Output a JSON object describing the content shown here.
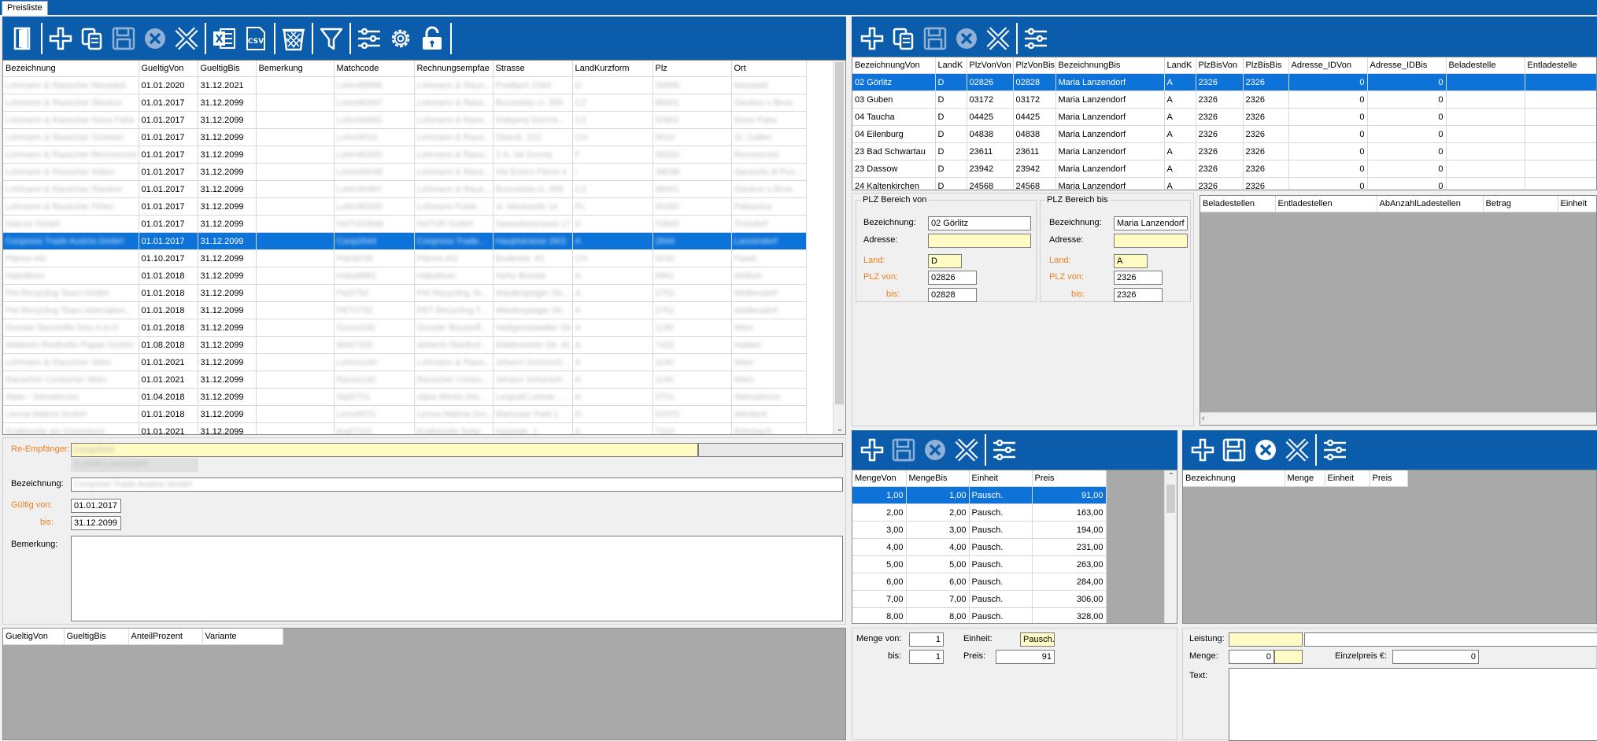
{
  "window": {
    "tab_title": "Preisliste"
  },
  "main_table": {
    "headers": [
      "Bezeichnung",
      "GueltigVon",
      "GueltigBis",
      "Bemerkung",
      "Matchcode",
      "Rechnungsempfae",
      "Strasse",
      "LandKurzform",
      "Plz",
      "Ort"
    ],
    "rows": [
      [
        "Lohmann & Rauscher Neuwied",
        "01.01.2020",
        "31.12.2021",
        "",
        "Lohm90996",
        "Lohmann & Raus...",
        "Postfach 2343",
        "D",
        "56566",
        "Neuwied"
      ],
      [
        "Lohmann & Rauscher Slavkov",
        "01.01.2017",
        "31.12.2099",
        "",
        "Lohm90497",
        "Lohmann & Raus...",
        "Bucovicka cl. 356",
        "CZ",
        "68401",
        "Slavkov u Brna"
      ],
      [
        "Lohmann & Rauscher Nova Paka",
        "01.01.2017",
        "31.12.2099",
        "",
        "Lohm90981",
        "Lohmann & Raus...",
        "Kldeprny Dorrcil...",
        "CZ",
        "50901",
        "Nova Paka"
      ],
      [
        "Lohmann & Rauscher Schweiz",
        "01.01.2017",
        "31.12.2099",
        "",
        "Lohm9014",
        "Lohmann & Raus...",
        "Oberdr. 222",
        "CH",
        "9014",
        "St. Gallen"
      ],
      [
        "Lohmann & Rauscher Rennesroot",
        "01.01.2017",
        "31.12.2099",
        "",
        "Lohm90200",
        "Lohmann & Raus...",
        "Z.A. Se Dromy",
        "F",
        "08200",
        "Rennesroot"
      ],
      [
        "Lohmann & Rauscher Italien",
        "01.01.2017",
        "31.12.2099",
        "",
        "Lohm39038",
        "Lohmann & Raus...",
        "Via Enrico Fermi 4",
        "I",
        "39038",
        "Sansorla di Pus..."
      ],
      [
        "Lohmann & Rauscher Slavkov",
        "01.01.2017",
        "31.12.2099",
        "",
        "Lohm90497",
        "Lohmann & Raus...",
        "Bucovicka cl. 356",
        "CZ",
        "68401",
        "Slavkov u Brna"
      ],
      [
        "Lohmann & Rauscher Polen",
        "01.01.2017",
        "31.12.2099",
        "",
        "Lohm95200",
        "Lohmann Polsk...",
        "ul. Moniuszki 14",
        "PL",
        "95200",
        "Pabianice"
      ],
      [
        "Natuvir GmbH",
        "01.01.2017",
        "31.12.2099",
        "",
        "NATU03648",
        "NATUR GmbH",
        "Gewerbestrasse 17",
        "D",
        "53840",
        "Troisdorf"
      ],
      [
        "Conpress Trade Austria GmbH",
        "01.01.2017",
        "31.12.2099",
        "",
        "Conp2644",
        "Conpress Trade...",
        "Hauptstrasse 26/3",
        "A",
        "2644",
        "Lanzendorf"
      ],
      [
        "Planox AG",
        "01.10.2017",
        "31.12.2099",
        "",
        "Plan9230",
        "Planox AG",
        "Bodenstr. 43",
        "CH",
        "9230",
        "Flawil"
      ],
      [
        "Habaltium",
        "01.01.2018",
        "31.12.2099",
        "",
        "Haba9961",
        "Habaltium",
        "Hohe Brucke",
        "A",
        "6961",
        "Wolfurt"
      ],
      [
        "Pet Recycling Team GmbH",
        "01.01.2018",
        "31.12.2099",
        "",
        "Pet2752",
        "Pet Recycling Te...",
        "Wiedenpeiger Str...",
        "A",
        "2752",
        "Wollersdorf"
      ],
      [
        "Pet Recycling Team Internation...",
        "01.01.2018",
        "31.12.2099",
        "",
        "PET2752",
        "PET Recycling T...",
        "Wiedenpeiger Str...",
        "A",
        "2752",
        "Wollersdorf"
      ],
      [
        "Gussler Baustoffe Ges.m.b.H",
        "01.01.2018",
        "31.12.2099",
        "",
        "Guss1190",
        "Gussler Baustoff...",
        "Heiligenstaedter Str...",
        "A",
        "1190",
        "Wien"
      ],
      [
        "Wellenin Riedhofer Papier GmbH",
        "01.08.2018",
        "31.12.2099",
        "",
        "Welt7432",
        "Welenin Riedhof...",
        "Waldmeister Str. 41",
        "A",
        "7432",
        "Halden"
      ],
      [
        "Lohmann & Rauscher Wien",
        "01.01.2021",
        "31.12.2099",
        "",
        "Lohm1140",
        "Lohmann & Raus...",
        "Johann Schorsch...",
        "A",
        "1140",
        "Wien"
      ],
      [
        "Rauscher Consumer Wien",
        "01.01.2021",
        "31.12.2099",
        "",
        "Raus1140",
        "Rauscher Consu...",
        "Johann Schorsch...",
        "A",
        "1140",
        "Wien"
      ],
      [
        "Alpla - Steinabrunn",
        "01.04.2018",
        "31.12.2099",
        "",
        "Alpl2751",
        "Alpla Werke Alw...",
        "Leopold Lehner ...",
        "A",
        "2751",
        "Steinabrunn"
      ],
      [
        "Lenna Watina GmbH",
        "01.01.2018",
        "31.12.2099",
        "",
        "Lenn5570",
        "Lenna Watina Gm...",
        "Manuater Feld 1",
        "D",
        "51570",
        "Windeck"
      ],
      [
        "Kraftquelle als Solarstrom",
        "01.01.2021",
        "31.12.2099",
        "",
        "Kraf7222",
        "Kraftquelle Solar...",
        "Hauptstr. 1",
        "A",
        "7222",
        "Rohrbach"
      ]
    ],
    "selected_index": 9
  },
  "detail": {
    "re_empfaenger_label": "Re-Empfänger:",
    "re_empfaenger_value": "Conp2644",
    "re_empfaenger_sub": "A-2644 Lanzendorf",
    "bezeichnung_label": "Bezeichnung:",
    "bezeichnung_value": "Conpress Trade Austria GmbH",
    "gueltig_von_label": "Gültig von:",
    "gueltig_von_value": "01.01.2017",
    "bis_label": "bis:",
    "bis_value": "31.12.2099",
    "bemerkung_label": "Bemerkung:"
  },
  "anteil_table": {
    "headers": [
      "GueltigVon",
      "GueltigBis",
      "AnteilProzent",
      "Variante"
    ]
  },
  "plz_table": {
    "headers": [
      "BezeichnungVon",
      "LandK",
      "PlzVonVon",
      "PlzVonBis",
      "BezeichnungBis",
      "LandK",
      "PlzBisVon",
      "PlzBisBis",
      "Adresse_IDVon",
      "Adresse_IDBis",
      "Beladestelle",
      "Entladestelle"
    ],
    "rows": [
      [
        "02 Görlitz",
        "D",
        "02826",
        "02828",
        "Maria Lanzendorf",
        "A",
        "2326",
        "2326",
        "0",
        "0",
        "",
        ""
      ],
      [
        "03 Guben",
        "D",
        "03172",
        "03172",
        "Maria Lanzendorf",
        "A",
        "2326",
        "2326",
        "0",
        "0",
        "",
        ""
      ],
      [
        "04 Taucha",
        "D",
        "04425",
        "04425",
        "Maria Lanzendorf",
        "A",
        "2326",
        "2326",
        "0",
        "0",
        "",
        ""
      ],
      [
        "04 Eilenburg",
        "D",
        "04838",
        "04838",
        "Maria Lanzendorf",
        "A",
        "2326",
        "2326",
        "0",
        "0",
        "",
        ""
      ],
      [
        "23 Bad Schwartau",
        "D",
        "23611",
        "23611",
        "Maria Lanzendorf",
        "A",
        "2326",
        "2326",
        "0",
        "0",
        "",
        ""
      ],
      [
        "23 Dassow",
        "D",
        "23942",
        "23942",
        "Maria Lanzendorf",
        "A",
        "2326",
        "2326",
        "0",
        "0",
        "",
        ""
      ],
      [
        "24 Kaltenkirchen",
        "D",
        "24568",
        "24568",
        "Maria Lanzendorf",
        "A",
        "2326",
        "2326",
        "0",
        "0",
        "",
        ""
      ]
    ]
  },
  "plz_von": {
    "title": "PLZ Bereich von",
    "bezeichnung_label": "Bezeichnung:",
    "bezeichnung_value": "02 Görlitz",
    "adresse_label": "Adresse:",
    "adresse_value": "",
    "land_label": "Land:",
    "land_value": "D",
    "plz_von_label": "PLZ von:",
    "plz_von_value": "02826",
    "bis_label": "bis:",
    "bis_value": "02828"
  },
  "plz_bis": {
    "title": "PLZ Bereich bis",
    "bezeichnung_label": "Bezeichnung:",
    "bezeichnung_value": "Maria Lanzendorf",
    "adresse_label": "Adresse:",
    "adresse_value": "",
    "land_label": "Land:",
    "land_value": "A",
    "plz_von_label": "PLZ von:",
    "plz_von_value": "2326",
    "bis_label": "bis:",
    "bis_value": "2326"
  },
  "belade_table": {
    "headers": [
      "Beladestellen",
      "Entladestellen",
      "AbAnzahlLadestellen",
      "Betrag",
      "Einheit"
    ]
  },
  "menge_table": {
    "headers": [
      "MengeVon",
      "MengeBis",
      "Einheit",
      "Preis"
    ],
    "rows": [
      [
        "1,00",
        "1,00",
        "Pausch.",
        "91,00"
      ],
      [
        "2,00",
        "2,00",
        "Pausch.",
        "163,00"
      ],
      [
        "3,00",
        "3,00",
        "Pausch.",
        "194,00"
      ],
      [
        "4,00",
        "4,00",
        "Pausch.",
        "231,00"
      ],
      [
        "5,00",
        "5,00",
        "Pausch.",
        "263,00"
      ],
      [
        "6,00",
        "6,00",
        "Pausch.",
        "284,00"
      ],
      [
        "7,00",
        "7,00",
        "Pausch.",
        "306,00"
      ],
      [
        "8,00",
        "8,00",
        "Pausch.",
        "328,00"
      ]
    ]
  },
  "menge_detail": {
    "menge_von_label": "Menge von:",
    "menge_von_value": "1",
    "bis_label": "bis:",
    "bis_value": "1",
    "einheit_label": "Einheit:",
    "einheit_value": "Pausch.",
    "preis_label": "Preis:",
    "preis_value": "91"
  },
  "leistung_table": {
    "headers": [
      "Bezeichnung",
      "Menge",
      "Einheit",
      "Preis"
    ]
  },
  "leistung_detail": {
    "leistung_label": "Leistung:",
    "leistung_value": "",
    "menge_label": "Menge:",
    "menge_value": "0",
    "einzelpreis_label": "Einzelpreis €:",
    "einzelpreis_value": "0",
    "text_label": "Text:"
  },
  "colors": {
    "toolbar": "#0b5cab",
    "selection": "#0e73d8",
    "required": "#f07f1e",
    "input_highlight": "#fffbc4"
  }
}
